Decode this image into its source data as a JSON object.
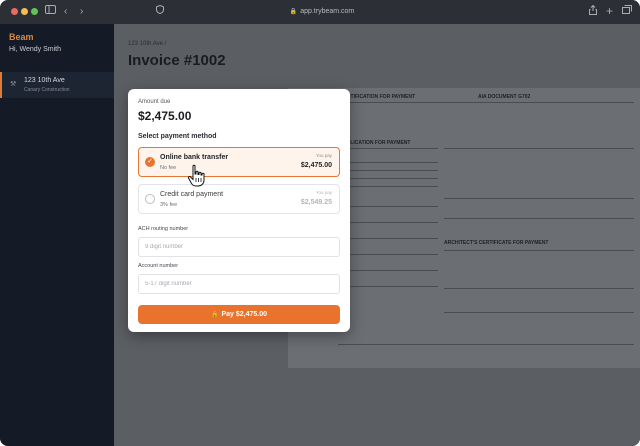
{
  "browser": {
    "url": "app.trybeam.com",
    "icons": [
      "sidebar-icon",
      "back-icon",
      "forward-icon",
      "shield-icon",
      "share-icon",
      "new-tab-icon",
      "tabs-icon"
    ]
  },
  "sidebar": {
    "brand": "Beam",
    "greeting": "Hi, Wendy Smith",
    "items": [
      {
        "title": "123 10th Ave",
        "subtitle": "Canary Construction"
      }
    ]
  },
  "main": {
    "breadcrumb": "123 10th Ave /",
    "title": "Invoice #1002"
  },
  "document": {
    "title_left": "CERTIFICATION FOR PAYMENT",
    "title_right": "AIA DOCUMENT G702",
    "section_left": "APPLICATION FOR PAYMENT",
    "section_right": "ARCHITECT'S CERTIFICATE FOR PAYMENT"
  },
  "modal": {
    "amount_label": "Amount due",
    "amount": "$2,475.00",
    "select_label": "Select payment method",
    "options": [
      {
        "name": "Online bank transfer",
        "fee": "No fee",
        "you_pay_label": "You pay",
        "amount": "$2,475.00",
        "selected": true
      },
      {
        "name": "Credit card payment",
        "fee": "3% fee",
        "you_pay_label": "You pay",
        "amount": "$2,549.25",
        "selected": false
      }
    ],
    "routing_label": "ACH routing number",
    "routing_placeholder": "9 digit number",
    "account_label": "Account number",
    "account_placeholder": "5-17 digit number",
    "pay_button": "Pay $2,475.00"
  },
  "colors": {
    "accent": "#e9722c",
    "sidebar_bg": "#141a26"
  }
}
